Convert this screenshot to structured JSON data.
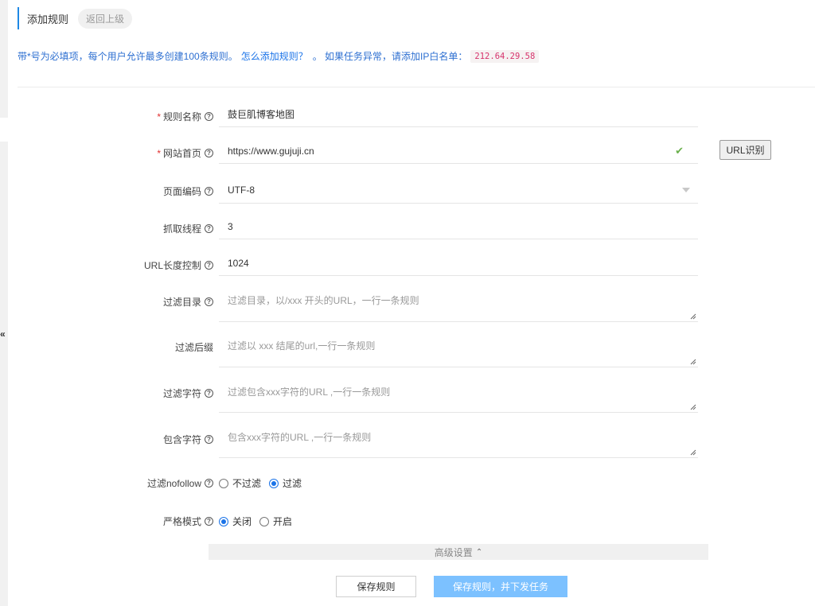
{
  "header": {
    "title": "添加规则",
    "back_label": "返回上级"
  },
  "notice": {
    "text": "带*号为必填项，每个用户允许最多创建100条规则。",
    "link": "怎么添加规则？",
    "suffix": "。 如果任务异常，请添加IP白名单：",
    "ip": "212.64.29.58"
  },
  "collapse_label": "«",
  "form": {
    "name": {
      "label": "规则名称",
      "value": "鼓巨肌博客地图"
    },
    "site": {
      "label": "网站首页",
      "value": "https://www.gujuji.cn"
    },
    "url_recognize_label": "URL识别",
    "encoding": {
      "label": "页面编码",
      "value": "UTF-8"
    },
    "threads": {
      "label": "抓取线程",
      "value": "3"
    },
    "url_length": {
      "label": "URL长度控制",
      "value": "1024"
    },
    "filter_dir": {
      "label": "过滤目录",
      "placeholder": "过滤目录，以/xxx 开头的URL，一行一条规则"
    },
    "filter_suffix": {
      "label": "过滤后缀",
      "placeholder": "过滤以 xxx 结尾的url,一行一条规则"
    },
    "filter_chars": {
      "label": "过滤字符",
      "placeholder": "过滤包含xxx字符的URL ,一行一条规则"
    },
    "include_chars": {
      "label": "包含字符",
      "placeholder": "包含xxx字符的URL ,一行一条规则"
    },
    "nofollow": {
      "label": "过滤nofollow",
      "options": [
        "不过滤",
        "过滤"
      ],
      "selected": "过滤"
    },
    "strict": {
      "label": "严格模式",
      "options": [
        "关闭",
        "开启"
      ],
      "selected": "关闭"
    }
  },
  "advanced_label": "高级设置",
  "buttons": {
    "save": "保存规则",
    "save_and_run": "保存规则，并下发任务"
  },
  "colors": {
    "accent": "#1a73e8",
    "primary_button": "#7cc1ff",
    "required": "#e03131",
    "check": "#6ab04c"
  }
}
